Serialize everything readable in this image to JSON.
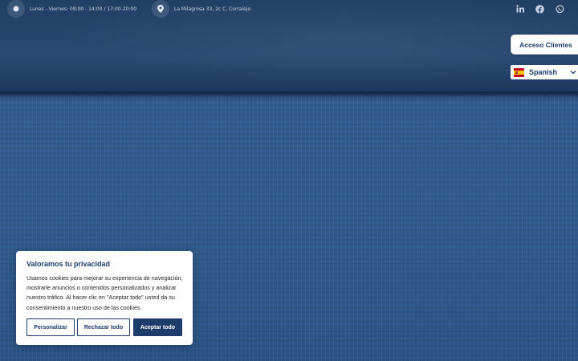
{
  "topbar": {
    "hours": "Lunes - Viernes: 09:00 - 14:00 / 17:00-20:00",
    "address": "La Milagrosa 33, 2c C, Corralejo",
    "icons": [
      "clock-icon",
      "location-pin-icon"
    ],
    "social": [
      "linkedin-icon",
      "facebook-icon",
      "whatsapp-icon"
    ]
  },
  "client_access": {
    "label": "Acceso Clientes"
  },
  "language": {
    "selected": "Spanish",
    "flag": "spain-flag-icon"
  },
  "cookie": {
    "title": "Valoramos tu privacidad",
    "body": "Usamos cookies para mejorar su experiencia de navegación, mostrarle anuncios o contenidos personalizados y analizar nuestro tráfico. Al hacer clic en \"Aceptar todo\" usted da su consentimiento a nuestro uso de las cookies.",
    "customize": "Personalizar",
    "reject": "Rechazar todo",
    "accept": "Aceptar todo"
  },
  "colors": {
    "brand": "#1d3c6b",
    "background": "#2f5a8c"
  }
}
